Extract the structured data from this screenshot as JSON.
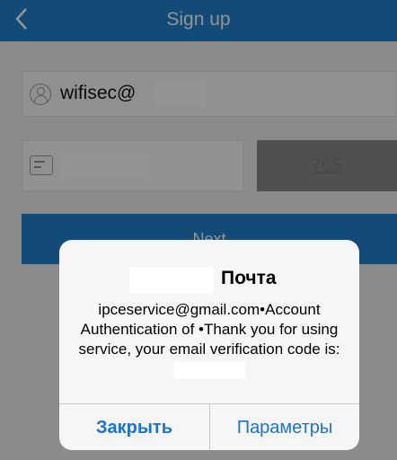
{
  "nav": {
    "title": "Sign up"
  },
  "form": {
    "email_value": "wifisec@",
    "resend_label": "76S",
    "next_label": "Next"
  },
  "alert": {
    "title": "Почта",
    "message": "ipceservice@gmail.com•Account Authentication of •Thank you for using service, your email verification code is:",
    "close_label": "Закрыть",
    "params_label": "Параметры"
  },
  "colors": {
    "accent": "#1f82cf",
    "link": "#1a73d8"
  }
}
